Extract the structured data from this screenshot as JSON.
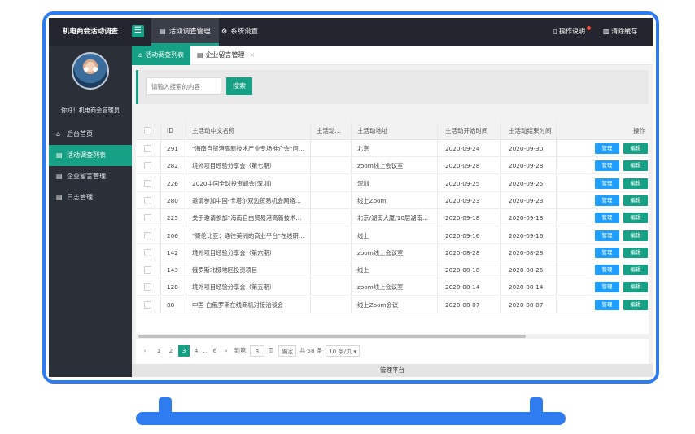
{
  "app": {
    "title": "机电商会活动调查"
  },
  "topnav": {
    "tabs": [
      {
        "label": "活动调查管理",
        "icon": "clipboard-icon",
        "active": true
      },
      {
        "label": "系统设置",
        "icon": "gear-icon",
        "active": false
      }
    ],
    "help_label": "操作说明",
    "clear_cache_label": "清除缓存"
  },
  "sidebar": {
    "greeting": "你好！机电商会管理员",
    "items": [
      {
        "label": "后台首页",
        "icon": "home-icon",
        "active": false
      },
      {
        "label": "活动调查列表",
        "icon": "document-icon",
        "active": true
      },
      {
        "label": "企业留言管理",
        "icon": "document-icon",
        "active": false
      },
      {
        "label": "日志管理",
        "icon": "document-icon",
        "active": false
      }
    ]
  },
  "page_tabs": [
    {
      "label": "活动调查列表",
      "icon": "home-icon",
      "active": true
    },
    {
      "label": "企业留言管理",
      "icon": "document-icon",
      "active": false,
      "close": "×"
    }
  ],
  "search": {
    "placeholder": "请输入搜索的内容",
    "button_label": "搜索"
  },
  "table": {
    "columns": [
      "ID",
      "主活动中文名称",
      "主活动…",
      "主活动地址",
      "主活动开始时间",
      "主活动结束时间",
      "操作"
    ],
    "rows": [
      {
        "id": "291",
        "name": "\"海南自贸港高新技术产业专场推介会\"问…",
        "short": "",
        "address": "北京",
        "start": "2020-09-24",
        "end": "2020-09-30"
      },
      {
        "id": "282",
        "name": "境外项目经验分享会（第七期）",
        "short": "",
        "address": "zoom线上会议室",
        "start": "2020-09-28",
        "end": "2020-09-28"
      },
      {
        "id": "226",
        "name": "2020中国全球投资峰会[深圳]",
        "short": "",
        "address": "深圳",
        "start": "2020-09-25",
        "end": "2020-09-25"
      },
      {
        "id": "280",
        "name": "邀请参加中国-卡塔尔双边贸易机会网络…",
        "short": "",
        "address": "线上Zoom",
        "start": "2020-09-23",
        "end": "2020-09-23"
      },
      {
        "id": "225",
        "name": "关于邀请参加\"海南自由贸易港高新技术…",
        "short": "",
        "address": "北京/湖南大厦/10层湖南…",
        "start": "2020-09-18",
        "end": "2020-09-18"
      },
      {
        "id": "206",
        "name": "\"哥伦比亚：通往美洲的商业平台\"在线研…",
        "short": "",
        "address": "线上",
        "start": "2020-09-16",
        "end": "2020-09-16"
      },
      {
        "id": "142",
        "name": "境外项目经验分享会（第六期）",
        "short": "",
        "address": "zoom线上会议室",
        "start": "2020-08-28",
        "end": "2020-08-28"
      },
      {
        "id": "143",
        "name": "俄罗斯北极地区投资项目",
        "short": "",
        "address": "线上",
        "start": "2020-08-18",
        "end": "2020-08-26"
      },
      {
        "id": "128",
        "name": "境外项目经验分享会（第五期）",
        "short": "",
        "address": "zoom线上会议室",
        "start": "2020-08-14",
        "end": "2020-08-14"
      },
      {
        "id": "88",
        "name": "中国-白俄罗斯在线商机对接洽谈会",
        "short": "",
        "address": "线上Zoom会议",
        "start": "2020-08-07",
        "end": "2020-08-07"
      }
    ],
    "manage_label": "管理",
    "edit_label": "编辑"
  },
  "pagination": {
    "prev": "‹",
    "pages": [
      "1",
      "2",
      "3",
      "4",
      "…",
      "6"
    ],
    "current": "3",
    "next": "›",
    "goto_prefix": "到第",
    "goto_value": "3",
    "goto_suffix": "页",
    "confirm": "确定",
    "total": "共 58 条",
    "page_size": "10 条/页"
  },
  "footer": {
    "text": "管理平台"
  },
  "colors": {
    "accent": "#16a085",
    "primary_blue": "#1e9fff",
    "frame": "#2f7bf0",
    "topbar": "#23262e",
    "sidebar": "#2b2f38"
  }
}
